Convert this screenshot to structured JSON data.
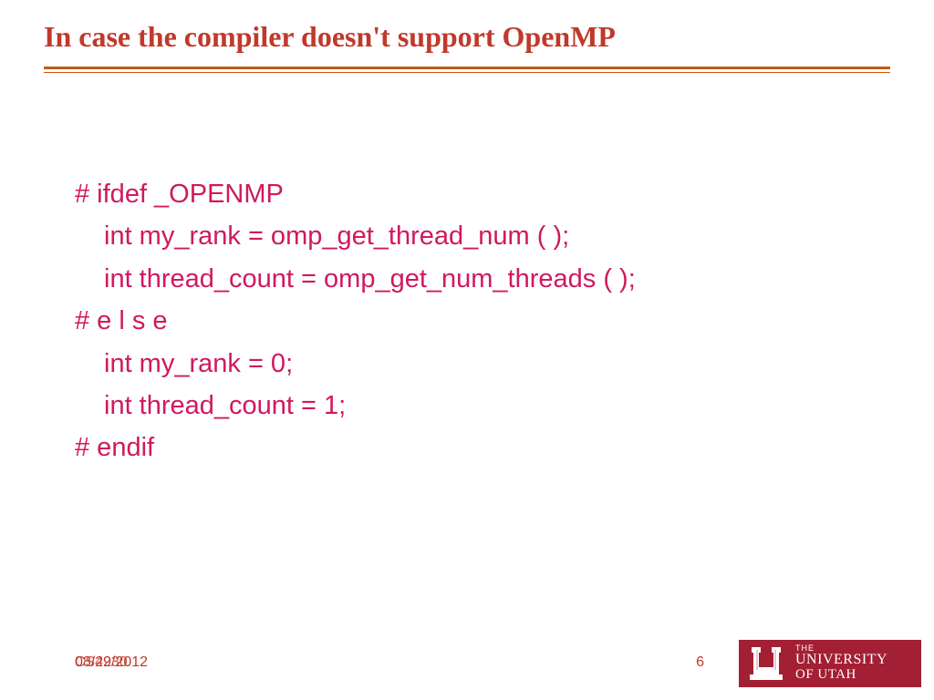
{
  "title": "In case the compiler doesn't support OpenMP",
  "code": {
    "l1": "# ifdef _OPENMP",
    "l2": "int my_rank = omp_get_thread_num ( );",
    "l3": "int thread_count = omp_get_num_threads ( );",
    "l4": "# e l s e",
    "l5": "int my_rank = 0;",
    "l6": "int thread_count = 1;",
    "l7": "# endif"
  },
  "footer": {
    "date1": "08/29/2012",
    "date2": "CS4230",
    "page": "6"
  },
  "logo": {
    "the": "THE",
    "line1": "UNIVERSITY",
    "line2": "OF UTAH"
  }
}
